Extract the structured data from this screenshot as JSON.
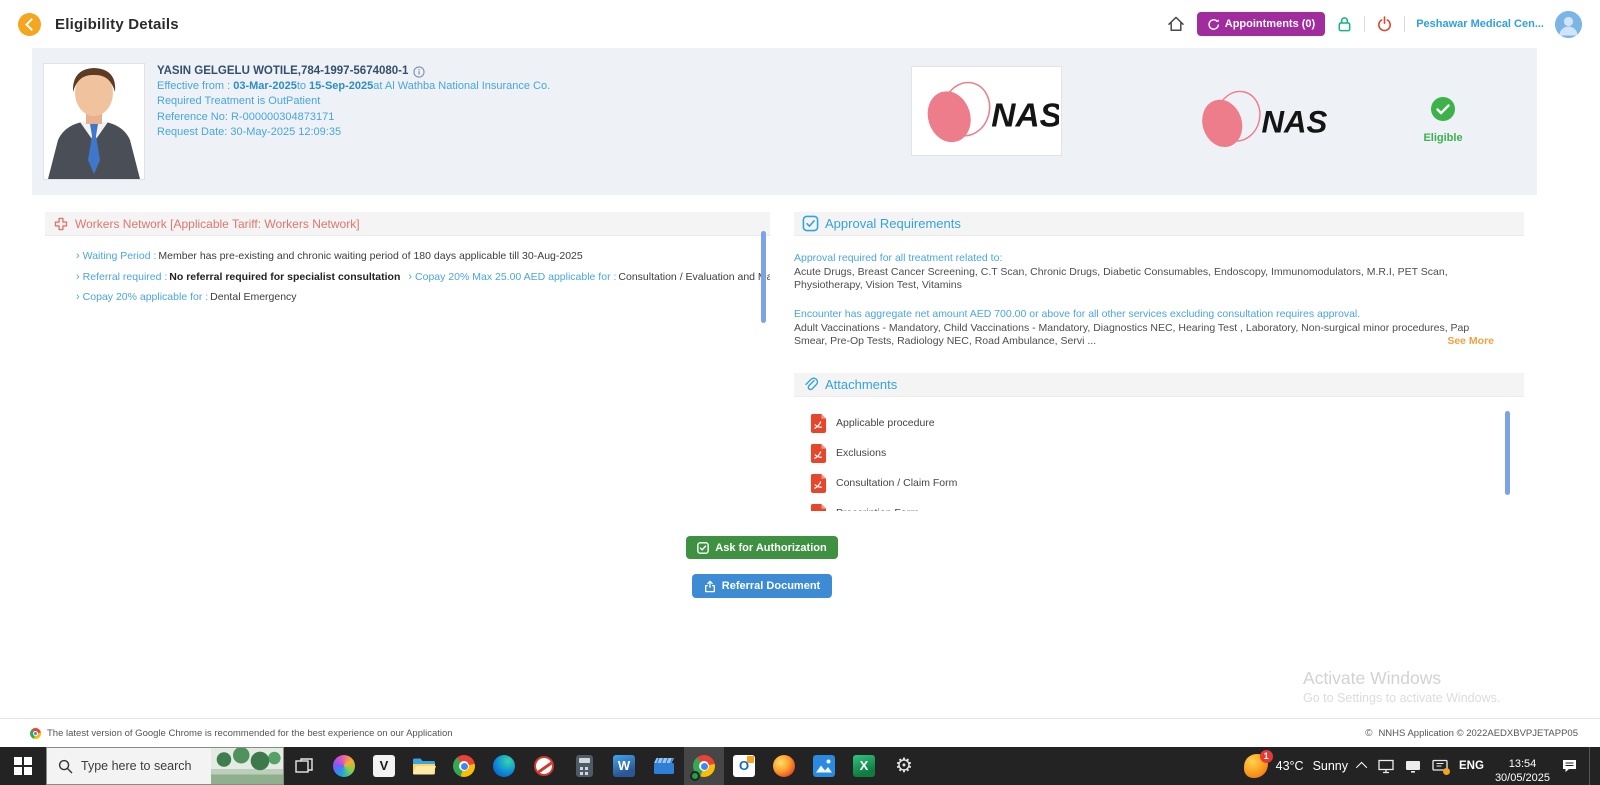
{
  "header": {
    "title": "Eligibility Details",
    "appointments_label": "Appointments (0)",
    "facility_name": "Peshawar Medical Cen...",
    "icons": {
      "back": "chevron-left-circle",
      "home": "house-outline",
      "appointments": "sync-arrows",
      "lock": "padlock-outline",
      "power": "power-symbol",
      "avatar": "person-in-circle"
    }
  },
  "patient": {
    "name_line": "YASIN GELGELU WOTILE,784-1997-5674080-1",
    "effective_prefix": "Effective from : ",
    "effective_from": "03-Mar-2025",
    "effective_mid": "to ",
    "effective_to": "15-Sep-2025",
    "effective_suffix": "at Al Wathba National Insurance Co.",
    "treatment_line": "Required Treatment is OutPatient",
    "reference_line": "Reference No: R-000000304873171",
    "request_line": "Request Date: 30-May-2025 12:09:35",
    "insurer_logo_text": "NAS",
    "eligibility_status": "Eligible"
  },
  "network_section": {
    "title": "Workers Network [Applicable Tariff: Workers Network]",
    "bullet_glyph": "›",
    "rows": [
      [
        {
          "label": "Waiting Period :",
          "value": "Member has pre-existing and chronic waiting period of 180 days applicable till 30-Aug-2025",
          "bold": false
        }
      ],
      [
        {
          "label": "Referral required :",
          "value": "No referral required for specialist consultation",
          "bold": true
        },
        {
          "label": "Copay 20% Max 25.00 AED applicable for :",
          "value": "Consultation / Evaluation and Management, Teleconsultations",
          "bold": false
        }
      ],
      [
        {
          "label": "Copay 20% applicable for :",
          "value": "Dental Emergency",
          "bold": false
        }
      ]
    ]
  },
  "approval_section": {
    "title": "Approval Requirements",
    "groups": [
      {
        "heading": "Approval required for all treatment related to:",
        "body": "Acute Drugs, Breast Cancer Screening, C.T Scan, Chronic Drugs, Diabetic Consumables, Endoscopy, Immunomodulators, M.R.I, PET Scan, Physiotherapy, Vision Test, Vitamins"
      },
      {
        "heading": "Encounter has aggregate net amount AED 700.00 or above for all other services excluding consultation requires approval.",
        "body": "Adult Vaccinations - Mandatory, Child Vaccinations - Mandatory, Diagnostics NEC, Hearing Test , Laboratory, Non-surgical minor procedures, Pap Smear, Pre-Op Tests, Radiology NEC, Road Ambulance, Servi ..."
      }
    ],
    "see_more": "See More"
  },
  "attachments_section": {
    "title": "Attachments",
    "file_icon": "pdf-file",
    "files": [
      "Applicable procedure",
      "Exclusions",
      "Consultation / Claim Form",
      "Prescription Form"
    ]
  },
  "actions": {
    "authorize_label": "Ask for Authorization",
    "referral_label": "Referral Document"
  },
  "watermark": {
    "line1": "Activate Windows",
    "line2": "Go to Settings to activate Windows."
  },
  "footer": {
    "left_text": "The latest version of Google Chrome is recommended for the best experience on our Application",
    "right_text": "NNHS Application © 2022AEDXBVPJETAPP05"
  },
  "taskbar": {
    "search_placeholder": "Type here to search",
    "icons": [
      {
        "name": "task-view"
      },
      {
        "name": "copilot"
      },
      {
        "name": "v-player",
        "glyph": "V"
      },
      {
        "name": "file-explorer"
      },
      {
        "name": "chrome"
      },
      {
        "name": "edge"
      },
      {
        "name": "media-cutter"
      },
      {
        "name": "calculator"
      },
      {
        "name": "word",
        "glyph": "W"
      },
      {
        "name": "video-editor"
      },
      {
        "name": "chrome-active"
      },
      {
        "name": "outlook",
        "glyph": "O"
      },
      {
        "name": "firefox"
      },
      {
        "name": "photos"
      },
      {
        "name": "excel",
        "glyph": "X"
      },
      {
        "name": "settings",
        "glyph": "⚙"
      }
    ],
    "tray": {
      "weather_badge": "1",
      "temp": "43°C",
      "condition": "Sunny",
      "language": "ENG",
      "time": "13:54",
      "date": "30/05/2025"
    }
  },
  "colors": {
    "accent_orange": "#F5A61F",
    "appointments_purple": "#A12C9E",
    "section_blue": "#35A3DC",
    "label_blue": "#4AA6DD",
    "coral": "#E0766C",
    "eligible_green": "#3DB24A",
    "button_green": "#3F9142",
    "button_blue": "#3D8BD4",
    "pdf_red": "#E5472D",
    "see_more_orange": "#F0A23C",
    "nas_pink": "#EE7D8B"
  }
}
